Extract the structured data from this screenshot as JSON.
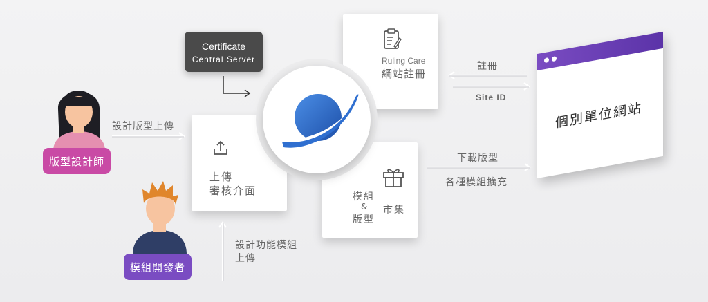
{
  "certificate": {
    "line1": "Certificate",
    "line2": "Central Server"
  },
  "ruling": {
    "line1": "Ruling Care",
    "line2": "網站註冊"
  },
  "upload": {
    "line1": "上傳",
    "line2": "審核介面"
  },
  "market": {
    "left1": "模組",
    "amp": "&",
    "left2": "版型",
    "right": "市集"
  },
  "roles": {
    "designer": "版型設計師",
    "developer": "模組開發者"
  },
  "edges": {
    "design_upload": "設計版型上傳",
    "module_upload_1": "設計功能模組",
    "module_upload_2": "上傳",
    "register": "註冊",
    "site_id": "Site ID",
    "download": "下載版型",
    "extensions": "各種模組擴充"
  },
  "website": {
    "title": "個別單位網站"
  },
  "colors": {
    "planet": "#2f6fd0",
    "designer": "#c94aa5",
    "developer": "#7a4cc2",
    "browser_bar": "#6a3cb8",
    "server_box": "#4a4a4a"
  }
}
